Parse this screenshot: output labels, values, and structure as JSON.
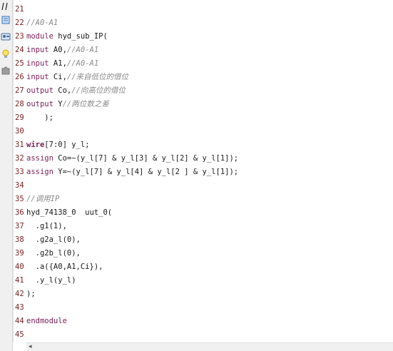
{
  "toolbar": {
    "icons": [
      "comment-toggle-icon",
      "block-icon",
      "template-icon",
      "bulb-icon",
      "puzzle-icon"
    ]
  },
  "editor": {
    "lines": [
      {
        "n": "21",
        "parts": []
      },
      {
        "n": "22",
        "parts": [
          {
            "t": "//A0-A1",
            "c": "cm"
          }
        ]
      },
      {
        "n": "23",
        "parts": [
          {
            "t": "module",
            "c": "kw"
          },
          {
            "t": " hyd_sub_IP(",
            "c": ""
          }
        ]
      },
      {
        "n": "24",
        "parts": [
          {
            "t": "input",
            "c": "kw"
          },
          {
            "t": " A0,",
            "c": ""
          },
          {
            "t": "//A0-A1",
            "c": "cm"
          }
        ]
      },
      {
        "n": "25",
        "parts": [
          {
            "t": "input",
            "c": "kw"
          },
          {
            "t": " A1,",
            "c": ""
          },
          {
            "t": "//A0-A1",
            "c": "cm"
          }
        ]
      },
      {
        "n": "26",
        "parts": [
          {
            "t": "input",
            "c": "kw"
          },
          {
            "t": " Ci,",
            "c": ""
          },
          {
            "t": "//来自低位的借位",
            "c": "cm"
          }
        ]
      },
      {
        "n": "27",
        "parts": [
          {
            "t": "output",
            "c": "kw"
          },
          {
            "t": " Co,",
            "c": ""
          },
          {
            "t": "//向高位的借位",
            "c": "cm"
          }
        ]
      },
      {
        "n": "28",
        "parts": [
          {
            "t": "output",
            "c": "kw"
          },
          {
            "t": " Y",
            "c": ""
          },
          {
            "t": "//两位数之差",
            "c": "cm"
          }
        ]
      },
      {
        "n": "29",
        "parts": [
          {
            "t": "    );",
            "c": ""
          }
        ]
      },
      {
        "n": "30",
        "parts": []
      },
      {
        "n": "31",
        "parts": [
          {
            "t": "wire",
            "c": "kwb"
          },
          {
            "t": "[7:0] y_l;",
            "c": ""
          }
        ]
      },
      {
        "n": "32",
        "parts": [
          {
            "t": "assign",
            "c": "kw"
          },
          {
            "t": " Co=~(y_l[7] & y_l[3] & y_l[2] & y_l[1]);",
            "c": ""
          }
        ]
      },
      {
        "n": "33",
        "parts": [
          {
            "t": "assign",
            "c": "kw"
          },
          {
            "t": " Y=~(y_l[7] & y_l[4] & y_l[2 ] & y_l[1]);",
            "c": ""
          }
        ]
      },
      {
        "n": "34",
        "parts": []
      },
      {
        "n": "35",
        "parts": [
          {
            "t": "//调用IP",
            "c": "cm"
          }
        ]
      },
      {
        "n": "36",
        "parts": [
          {
            "t": "hyd_74138_0  uut_0(",
            "c": ""
          }
        ]
      },
      {
        "n": "37",
        "parts": [
          {
            "t": "  .g1(1),",
            "c": ""
          }
        ]
      },
      {
        "n": "38",
        "parts": [
          {
            "t": "  .g2a_l(0),",
            "c": ""
          }
        ]
      },
      {
        "n": "39",
        "parts": [
          {
            "t": "  .g2b_l(0),",
            "c": ""
          }
        ]
      },
      {
        "n": "40",
        "parts": [
          {
            "t": "  .a({A0,A1,Ci}),",
            "c": ""
          }
        ]
      },
      {
        "n": "41",
        "parts": [
          {
            "t": "  .y_l(y_l)",
            "c": ""
          }
        ]
      },
      {
        "n": "42",
        "parts": [
          {
            "t": ");",
            "c": ""
          }
        ]
      },
      {
        "n": "43",
        "parts": []
      },
      {
        "n": "44",
        "parts": [
          {
            "t": "endmodule",
            "c": "kw"
          }
        ]
      },
      {
        "n": "45",
        "parts": []
      }
    ]
  },
  "scrollbar": {
    "left_arrow": "◂"
  }
}
